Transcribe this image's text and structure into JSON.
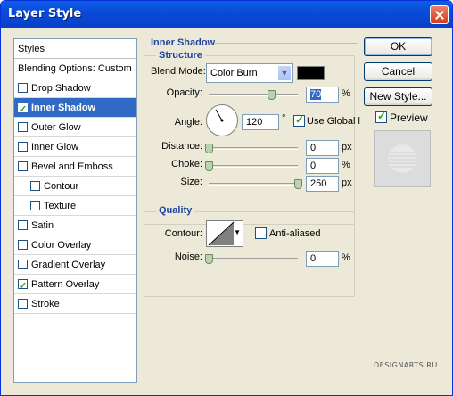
{
  "window": {
    "title": "Layer Style"
  },
  "styles_panel": {
    "header": "Styles",
    "items": [
      {
        "label": "Blending Options: Custom",
        "checkbox": false,
        "checked": false,
        "selected": false,
        "indent": false
      },
      {
        "label": "Drop Shadow",
        "checkbox": true,
        "checked": false,
        "selected": false,
        "indent": false
      },
      {
        "label": "Inner Shadow",
        "checkbox": true,
        "checked": true,
        "selected": true,
        "indent": false
      },
      {
        "label": "Outer Glow",
        "checkbox": true,
        "checked": false,
        "selected": false,
        "indent": false
      },
      {
        "label": "Inner Glow",
        "checkbox": true,
        "checked": false,
        "selected": false,
        "indent": false
      },
      {
        "label": "Bevel and Emboss",
        "checkbox": true,
        "checked": false,
        "selected": false,
        "indent": false
      },
      {
        "label": "Contour",
        "checkbox": true,
        "checked": false,
        "selected": false,
        "indent": true
      },
      {
        "label": "Texture",
        "checkbox": true,
        "checked": false,
        "selected": false,
        "indent": true
      },
      {
        "label": "Satin",
        "checkbox": true,
        "checked": false,
        "selected": false,
        "indent": false
      },
      {
        "label": "Color Overlay",
        "checkbox": true,
        "checked": false,
        "selected": false,
        "indent": false
      },
      {
        "label": "Gradient Overlay",
        "checkbox": true,
        "checked": false,
        "selected": false,
        "indent": false
      },
      {
        "label": "Pattern Overlay",
        "checkbox": true,
        "checked": true,
        "selected": false,
        "indent": false
      },
      {
        "label": "Stroke",
        "checkbox": true,
        "checked": false,
        "selected": false,
        "indent": false
      }
    ]
  },
  "inner_shadow": {
    "section_title": "Inner Shadow",
    "structure": {
      "title": "Structure",
      "blend_mode_label": "Blend Mode:",
      "blend_mode_value": "Color Burn",
      "color_swatch": "#000000",
      "opacity_label": "Opacity:",
      "opacity_value": "70",
      "opacity_fraction": 0.7,
      "opacity_unit": "%",
      "angle_label": "Angle:",
      "angle_value": "120",
      "angle_unit": "°",
      "use_global_light_label": "Use Global l",
      "use_global_light_checked": true,
      "distance_label": "Distance:",
      "distance_value": "0",
      "distance_fraction": 0.0,
      "distance_unit": "px",
      "choke_label": "Choke:",
      "choke_value": "0",
      "choke_fraction": 0.0,
      "choke_unit": "%",
      "size_label": "Size:",
      "size_value": "250",
      "size_fraction": 1.0,
      "size_unit": "px"
    },
    "quality": {
      "title": "Quality",
      "contour_label": "Contour:",
      "anti_aliased_label": "Anti-aliased",
      "anti_aliased_checked": false,
      "noise_label": "Noise:",
      "noise_value": "0",
      "noise_fraction": 0.0,
      "noise_unit": "%"
    }
  },
  "buttons": {
    "ok": "OK",
    "cancel": "Cancel",
    "new_style": "New Style...",
    "preview_label": "Preview",
    "preview_checked": true
  },
  "watermark": "DESIGNARTS.RU"
}
